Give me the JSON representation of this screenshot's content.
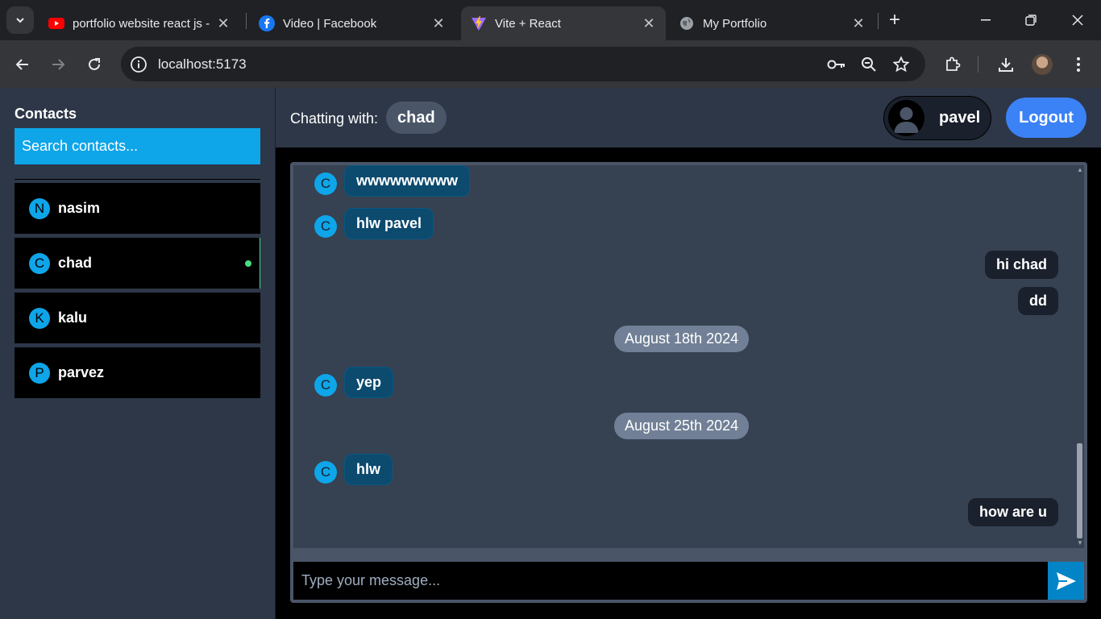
{
  "browser": {
    "tabs": [
      {
        "title": "portfolio website react js -",
        "favicon": "youtube-icon",
        "active": false
      },
      {
        "title": "Video | Facebook",
        "favicon": "facebook-icon",
        "active": false
      },
      {
        "title": "Vite + React",
        "favicon": "vite-icon",
        "active": true
      },
      {
        "title": "My Portfolio",
        "favicon": "globe-icon",
        "active": false
      }
    ],
    "url": "localhost:5173",
    "colors": {
      "chrome_dark": "#202124",
      "toolbar": "#35363a"
    }
  },
  "sidebar": {
    "title": "Contacts",
    "search_placeholder": "Search contacts...",
    "contacts": [
      {
        "initial": "N",
        "name": "nasim",
        "online": false
      },
      {
        "initial": "C",
        "name": "chad",
        "online": true
      },
      {
        "initial": "K",
        "name": "kalu",
        "online": false
      },
      {
        "initial": "P",
        "name": "parvez",
        "online": false
      }
    ]
  },
  "header": {
    "chatting_label": "Chatting with:",
    "chatting_with": "chad",
    "current_user": "pavel",
    "logout_label": "Logout"
  },
  "messages": [
    {
      "type": "in",
      "avatar": "C",
      "text": "wwwwwwwww"
    },
    {
      "type": "in",
      "avatar": "C",
      "text": "hlw pavel"
    },
    {
      "type": "out",
      "text": "hi chad"
    },
    {
      "type": "out",
      "text": "dd"
    },
    {
      "type": "date",
      "text": "August 18th 2024"
    },
    {
      "type": "in",
      "avatar": "C",
      "text": "yep"
    },
    {
      "type": "date",
      "text": "August 25th 2024"
    },
    {
      "type": "in",
      "avatar": "C",
      "text": "hlw"
    },
    {
      "type": "out",
      "text": "how are u"
    }
  ],
  "composer": {
    "placeholder": "Type your message..."
  },
  "colors": {
    "accent": "#0ea5e9",
    "logout": "#3b82f6",
    "online": "#4ade80",
    "incoming_bubble": "#0c4a6e",
    "outgoing_bubble": "#1a202c"
  }
}
